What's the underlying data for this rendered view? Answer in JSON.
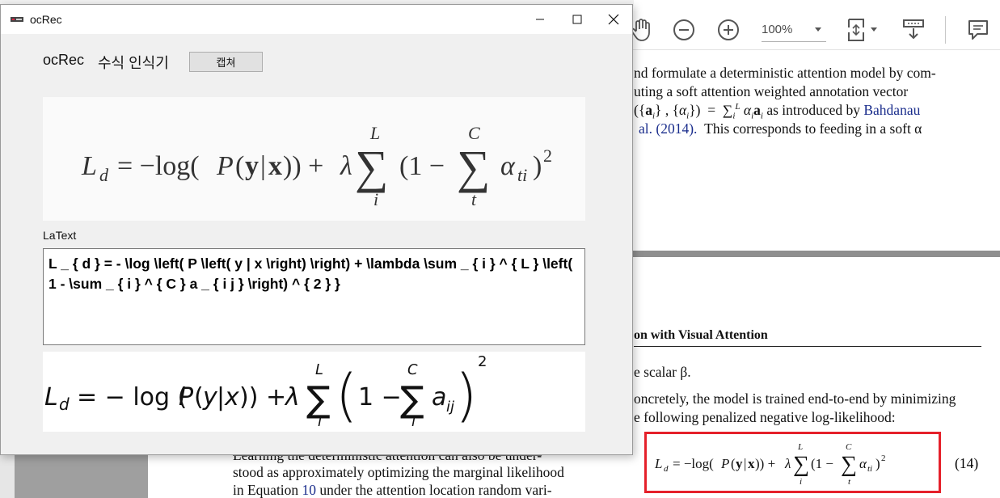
{
  "pdf_viewer": {
    "zoom": "100%",
    "paragraph_lines": [
      "nd formulate a deterministic attention model by com-",
      "uting  a  soft  attention  weighted  annotation  vector",
      "({a",
      "al. (2014).  This corresponds to feeding in a soft"
    ],
    "para_line3_mid": "as introduced by",
    "para_line3_link": "Bahdanau",
    "para_line4_link": "al. (2014).",
    "para_line4_rest": "This corresponds to feeding in a soft α",
    "heading_fragment": "on with Visual Attention",
    "scalar_line": "e scalar β.",
    "concretely_line": "oncretely, the model is trained end-to-end by minimizing",
    "following_line": "e following penalized negative log-likelihood:",
    "equation_number": "(14)",
    "bottom_lines": [
      "Learning  the  deterministic  attention  can  also  be  under-",
      "stood as approximately optimizing the marginal likelihood",
      "in Equation",
      "under the attention location random vari-"
    ],
    "equation_link": "10"
  },
  "app": {
    "window_title": "ocRec",
    "app_name": "ocRec",
    "subtitle": "수식 인식기",
    "capture_label": "캡쳐",
    "latex_label": "LaText",
    "latex_text": "L _ { d } = - \\log \\left( P \\left( y | x \\right) \\right) + \\lambda \\sum _ { i } ^ { L } \\left( 1 - \\sum _ { i } ^ { C } a _ { i j } \\right) ^ { 2 } }"
  }
}
